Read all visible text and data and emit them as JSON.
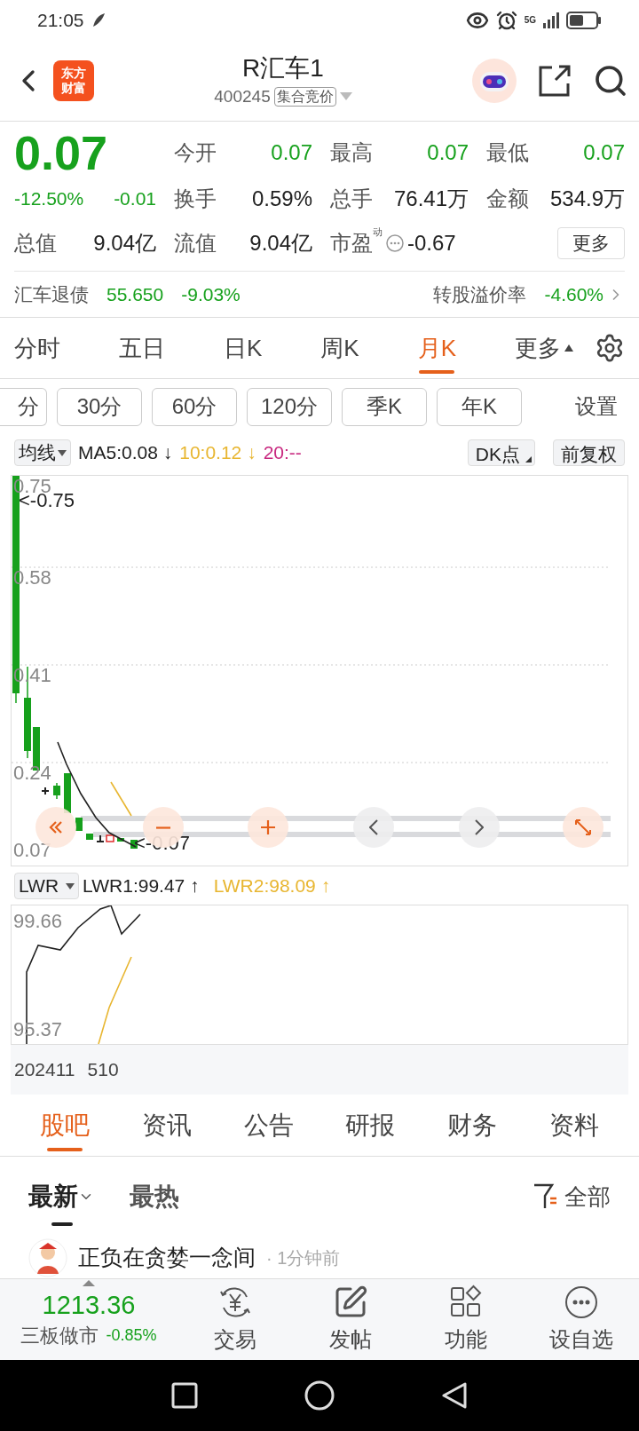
{
  "status_bar": {
    "time": "21:05",
    "network": "5G"
  },
  "header": {
    "logo_top": "东方",
    "logo_bottom": "财富",
    "title": "R汇车1",
    "code": "400245",
    "badge": "集合竞价"
  },
  "quote": {
    "price": "0.07",
    "change_pct": "-12.50%",
    "change": "-0.01",
    "stats": [
      {
        "label": "今开",
        "value": "0.07",
        "color": "#17a11d"
      },
      {
        "label": "最高",
        "value": "0.07",
        "color": "#17a11d"
      },
      {
        "label": "最低",
        "value": "0.07",
        "color": "#17a11d"
      },
      {
        "label": "换手",
        "value": "0.59%",
        "color": "#222222"
      },
      {
        "label": "总手",
        "value": "76.41万",
        "color": "#222222"
      },
      {
        "label": "金额",
        "value": "534.9万",
        "color": "#222222"
      }
    ],
    "valuation": [
      {
        "label": "总值",
        "value": "9.04亿"
      },
      {
        "label": "流值",
        "value": "9.04亿"
      },
      {
        "label": "市盈",
        "sup": "动",
        "value": "-0.67"
      }
    ],
    "more_button": "更多"
  },
  "bond": {
    "name": "汇车退债",
    "price": "55.650",
    "change": "-9.03%",
    "premium_label": "转股溢价率",
    "premium": "-4.60%"
  },
  "period_tabs": [
    {
      "label": "分时",
      "selected": false,
      "kind": "tab"
    },
    {
      "label": "五日",
      "selected": false,
      "kind": "tab"
    },
    {
      "label": "日K",
      "selected": false,
      "kind": "tab"
    },
    {
      "label": "周K",
      "selected": false,
      "kind": "tab"
    },
    {
      "label": "月K",
      "selected": true,
      "kind": "tab"
    },
    {
      "label": "更多",
      "selected": false,
      "kind": "menu"
    }
  ],
  "intervals": [
    "分",
    "30分",
    "60分",
    "120分",
    "季K",
    "年K"
  ],
  "interval_settings": "设置",
  "ma": {
    "selector": "均线",
    "ma5": "MA5:0.08 ↓",
    "ma10": "10:0.12 ↓",
    "ma20": "20:--",
    "dk": "DK点",
    "adjust": "前复权"
  },
  "kline": {
    "y_labels": [
      "0.75",
      "0.58",
      "0.41",
      "0.24",
      "0.07"
    ],
    "max_marker": "<-0.75",
    "min_marker": "<-0.07"
  },
  "indicator": {
    "selector": "LWR",
    "lwr1": "LWR1:99.47 ↑",
    "lwr2": "LWR2:98.09 ↑",
    "y_labels": [
      "99.66",
      "95.37"
    ],
    "date_labels": [
      "202411",
      "510"
    ]
  },
  "content_tabs": [
    {
      "label": "股吧",
      "selected": true
    },
    {
      "label": "资讯",
      "selected": false
    },
    {
      "label": "公告",
      "selected": false
    },
    {
      "label": "研报",
      "selected": false
    },
    {
      "label": "财务",
      "selected": false
    },
    {
      "label": "资料",
      "selected": false
    }
  ],
  "sort": [
    {
      "label": "最新",
      "selected": true
    },
    {
      "label": "最热",
      "selected": false
    }
  ],
  "filter": "全部",
  "post": {
    "author": "正负在贪婪一念间",
    "time": "· 1分钟前"
  },
  "bottom_bar": {
    "index_value": "1213.36",
    "index_name": "三板做市",
    "index_change": "-0.85%",
    "actions": [
      {
        "label": "交易",
        "kind": "trade"
      },
      {
        "label": "发帖",
        "kind": "post"
      },
      {
        "label": "功能",
        "kind": "apps"
      },
      {
        "label": "设自选",
        "kind": "watch"
      }
    ]
  }
}
